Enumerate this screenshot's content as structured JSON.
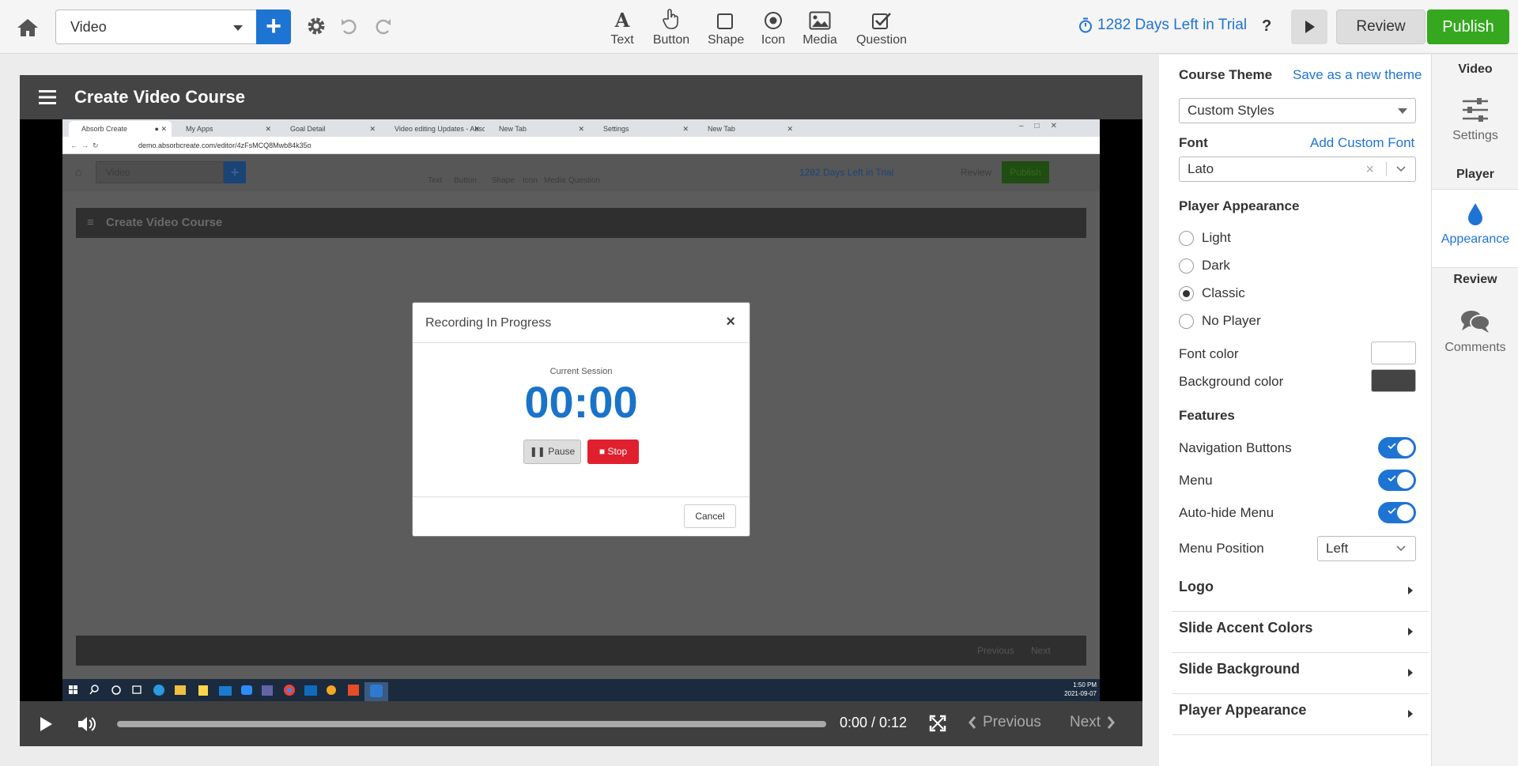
{
  "topbar": {
    "page_select": "Video",
    "add_label": "+",
    "tools": [
      {
        "label": "Text",
        "icon": "text-icon"
      },
      {
        "label": "Button",
        "icon": "pointer-hand-icon"
      },
      {
        "label": "Shape",
        "icon": "square-icon"
      },
      {
        "label": "Icon",
        "icon": "target-icon"
      },
      {
        "label": "Media",
        "icon": "image-icon"
      },
      {
        "label": "Question",
        "icon": "checkbox-icon"
      }
    ],
    "trial_text": "1282 Days Left in Trial",
    "help": "?",
    "review": "Review",
    "publish": "Publish"
  },
  "player": {
    "title": "Create Video Course",
    "time": "0:00 / 0:12",
    "previous": "Previous",
    "next": "Next",
    "progress": 0
  },
  "recording": {
    "browser_tabs": [
      "Absorb Create",
      "My Apps",
      "Goal Detail",
      "Video editing Updates - Absorb",
      "New Tab",
      "Settings",
      "New Tab"
    ],
    "url": "demo.absorbcreate.com/editor/4zFsMCQ8Mwb84k35o",
    "inner": {
      "page_select": "Video",
      "tools": [
        "Text",
        "Button",
        "Shape",
        "Icon",
        "Media",
        "Question"
      ],
      "trial_text": "1282 Days Left in Trial",
      "review": "Review",
      "publish": "Publish",
      "title": "Create Video Course",
      "previous": "Previous",
      "next": "Next"
    },
    "modal": {
      "title": "Recording In Progress",
      "close": "×",
      "session_label": "Current Session",
      "timer": "00:00",
      "pause": "Pause",
      "stop": "Stop",
      "cancel": "Cancel"
    },
    "taskbar_clock": {
      "time": "1:50 PM",
      "date": "2021-09-07"
    }
  },
  "panel": {
    "course_theme_label": "Course Theme",
    "save_theme": "Save as a new theme",
    "theme_value": "Custom Styles",
    "font_label": "Font",
    "add_font": "Add Custom Font",
    "font_value": "Lato",
    "font_clear": "×",
    "player_appearance_label": "Player Appearance",
    "appearance_options": [
      "Light",
      "Dark",
      "Classic",
      "No Player"
    ],
    "appearance_selected": "Classic",
    "font_color_label": "Font color",
    "font_color": "#ffffff",
    "bg_color_label": "Background color",
    "bg_color": "#444444",
    "features_label": "Features",
    "features": [
      {
        "label": "Navigation Buttons",
        "on": true
      },
      {
        "label": "Menu",
        "on": true
      },
      {
        "label": "Auto-hide Menu",
        "on": true
      }
    ],
    "menu_position_label": "Menu Position",
    "menu_position_value": "Left",
    "sections": [
      "Logo",
      "Slide Accent Colors",
      "Slide Background",
      "Player Appearance"
    ]
  },
  "sidenav": {
    "video_header": "Video",
    "settings": "Settings",
    "player_header": "Player",
    "appearance": "Appearance",
    "review_header": "Review",
    "comments": "Comments"
  },
  "colors": {
    "accent": "#1e74d3",
    "publish": "#35a81f",
    "stop": "#e0202e",
    "player_bar": "#444444"
  }
}
